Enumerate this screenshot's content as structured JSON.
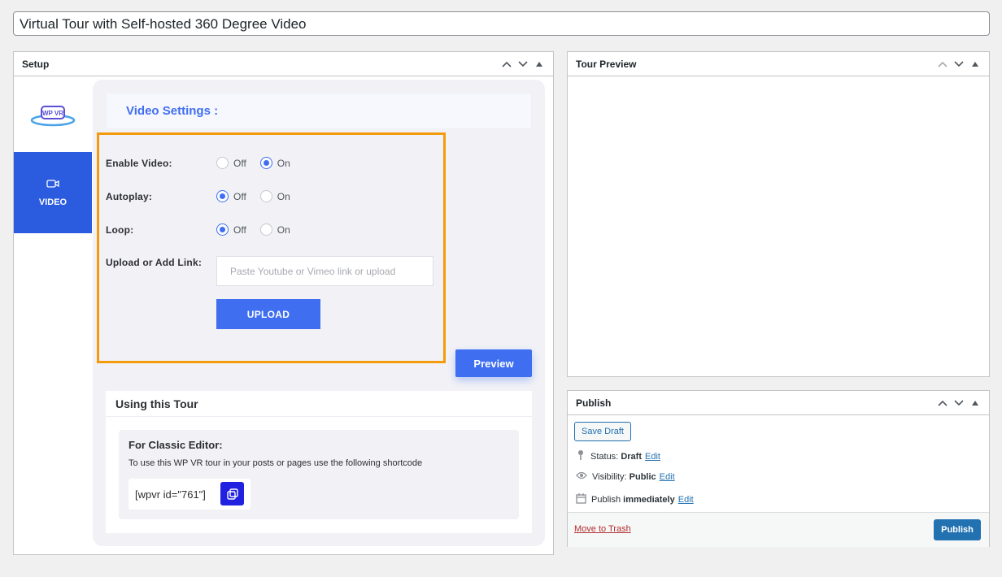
{
  "post": {
    "title": "Virtual Tour with Self-hosted 360 Degree Video"
  },
  "setup": {
    "title": "Setup",
    "logo_text": "WP VR",
    "tab_video": "VIDEO",
    "settings_heading": "Video Settings :",
    "enable_video": {
      "label": "Enable Video:",
      "off": "Off",
      "on": "On",
      "selected": "On"
    },
    "autoplay": {
      "label": "Autoplay:",
      "off": "Off",
      "on": "On",
      "selected": "Off"
    },
    "loop": {
      "label": "Loop:",
      "off": "Off",
      "on": "On",
      "selected": "Off"
    },
    "upload_label": "Upload or Add Link:",
    "link_placeholder": "Paste Youtube or Vimeo link or upload",
    "upload_button": "UPLOAD",
    "preview_button": "Preview",
    "usage": {
      "heading": "Using this Tour",
      "classic_heading": "For Classic Editor:",
      "classic_text": "To use this WP VR tour in your posts or pages use the following shortcode",
      "shortcode": "[wpvr id=\"761\"]"
    }
  },
  "tour_preview": {
    "title": "Tour Preview"
  },
  "publish": {
    "title": "Publish",
    "save_draft": "Save Draft",
    "status_label": "Status:",
    "status_value": "Draft",
    "visibility_label": "Visibility:",
    "visibility_value": "Public",
    "schedule_label": "Publish",
    "schedule_value": "immediately",
    "edit_link": "Edit",
    "trash": "Move to Trash",
    "publish_button": "Publish"
  },
  "colors": {
    "accent": "#3f6ef1",
    "highlight": "#f39b0d",
    "wp_blue": "#2271b1",
    "trash_red": "#b32d2e"
  }
}
